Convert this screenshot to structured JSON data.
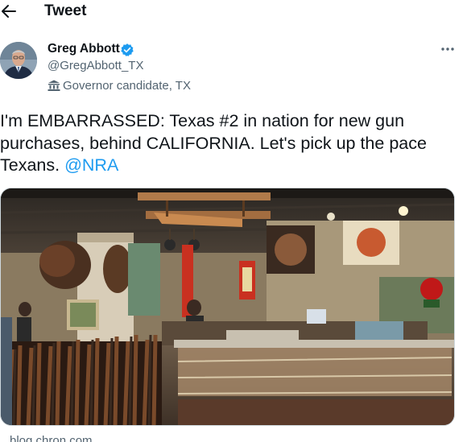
{
  "header": {
    "title": "Tweet"
  },
  "author": {
    "name": "Greg Abbott",
    "handle": "@GregAbbott_TX",
    "label": "Governor candidate, TX",
    "verified": true
  },
  "tweet": {
    "text_before": "I'm EMBARRASSED: Texas #2 in nation for new gun purchases, behind CALIFORNIA. Let's pick up the pace Texans. ",
    "mention": "@NRA"
  },
  "media": {
    "description_icon": "photo"
  },
  "link_card": {
    "domain": "blog.chron.com"
  },
  "colors": {
    "accent": "#1d9bf0",
    "verified": "#1d9bf0",
    "secondary_text": "#536471",
    "primary_text": "#0f1419"
  }
}
